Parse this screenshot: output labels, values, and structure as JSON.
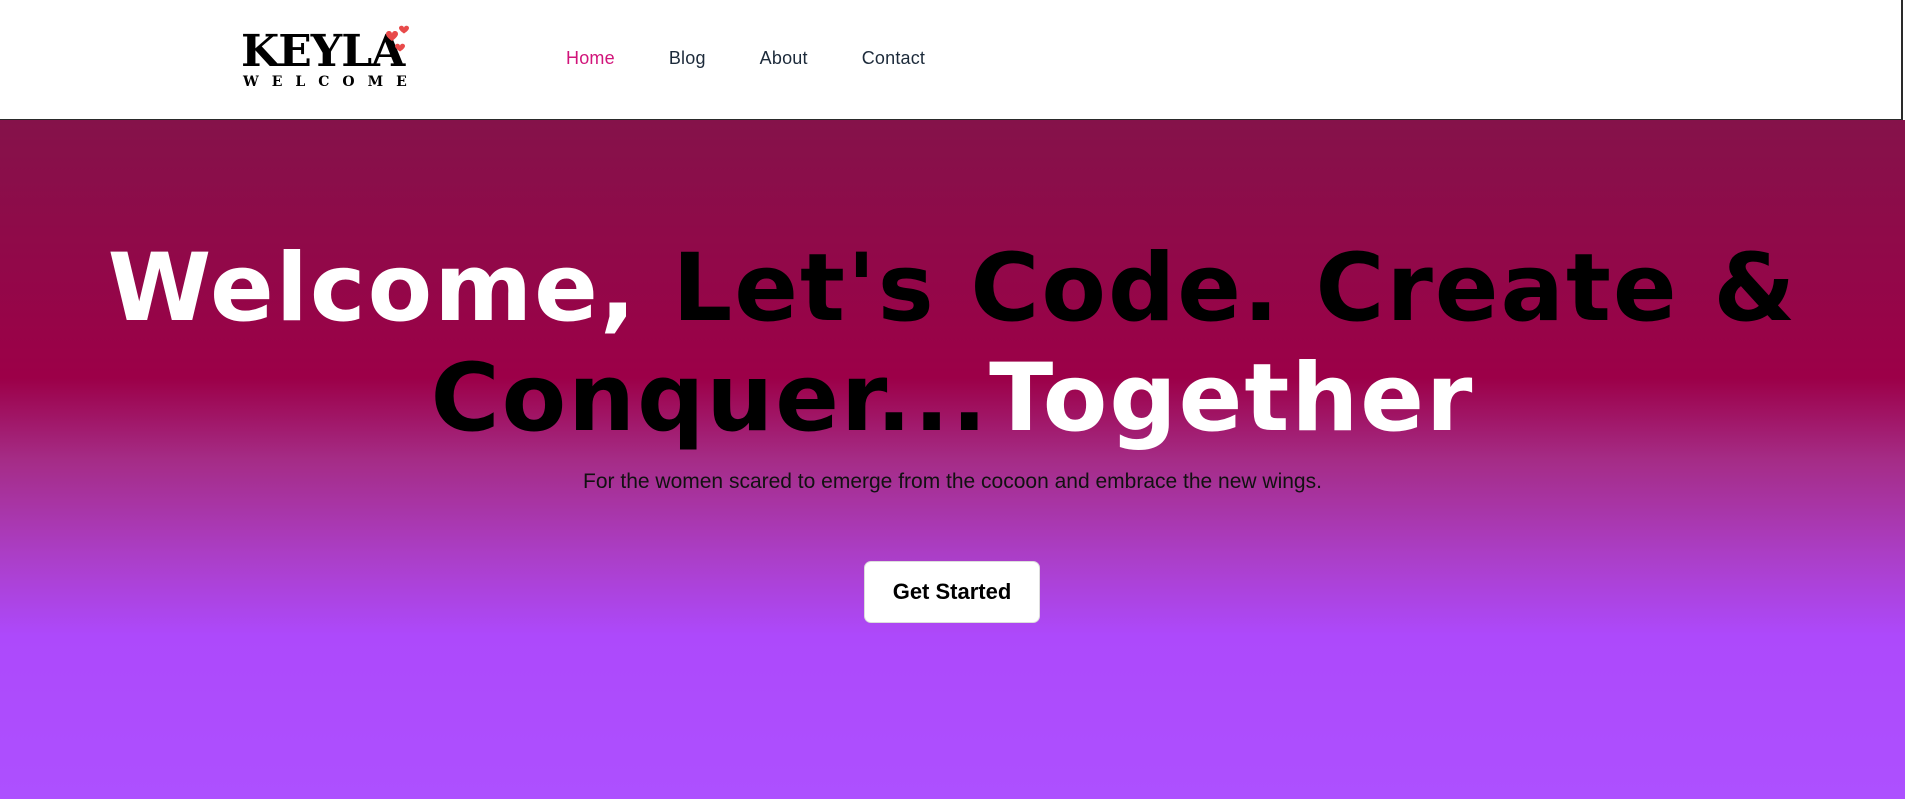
{
  "logo": {
    "main": "KEYLA",
    "sub": "WELCOME",
    "heart_color": "#e84a4a"
  },
  "nav": {
    "items": [
      {
        "label": "Home",
        "active": true
      },
      {
        "label": "Blog",
        "active": false
      },
      {
        "label": "About",
        "active": false
      },
      {
        "label": "Contact",
        "active": false
      }
    ],
    "active_color": "#d1147a"
  },
  "hero": {
    "headline": {
      "part1": "Welcome,",
      "part2": "Let's Code. Create & Conquer...",
      "part3": "Together"
    },
    "subtitle": "For the women scared to emerge from the cocoon and embrace the new wings.",
    "cta_label": "Get Started",
    "gradient_colors": [
      "#85124a",
      "#9c0048",
      "#ad50ff"
    ]
  }
}
